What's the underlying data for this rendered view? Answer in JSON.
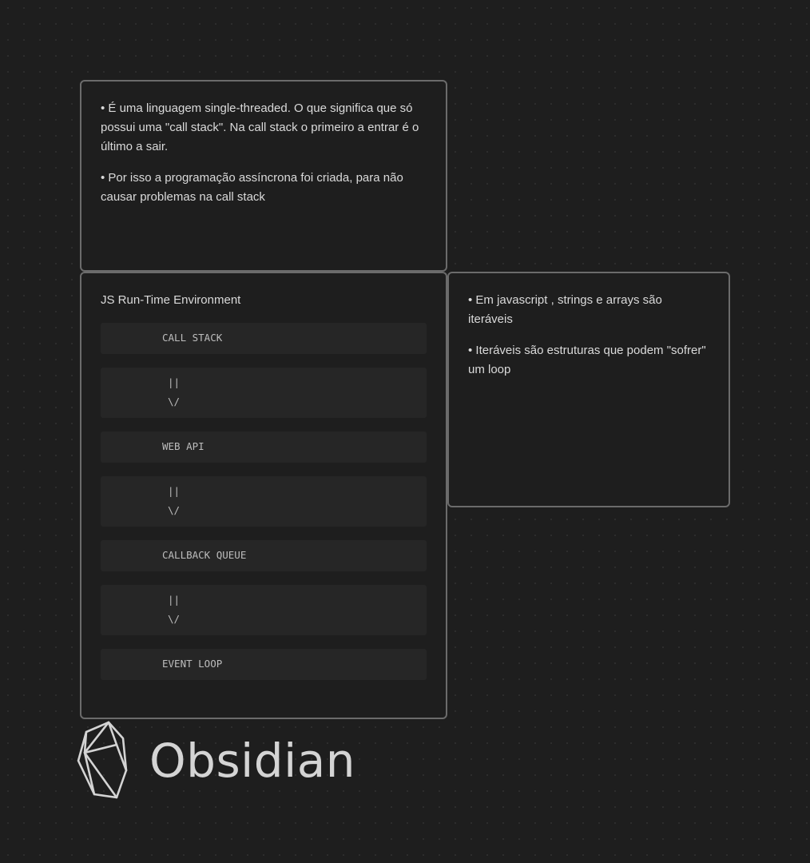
{
  "card_single_thread": {
    "bullets": [
      "É uma linguagem single-threaded. O que significa que só possui uma \"call stack\". Na call stack o primeiro a entrar é o último a sair.",
      "Por isso a programação assíncrona foi criada, para não causar problemas na call stack"
    ]
  },
  "card_runtime": {
    "title": "JS Run-Time Environment",
    "blocks": [
      "CALL STACK",
      "||\n\\/",
      "WEB API",
      "||\n\\/",
      "CALLBACK QUEUE",
      "||\n\\/",
      "EVENT LOOP"
    ]
  },
  "card_iterables": {
    "bullets": [
      "Em javascript , strings e arrays são iteráveis",
      "Iteráveis são estruturas que podem \"sofrer\" um loop"
    ]
  },
  "logo": {
    "text": "Obsidian",
    "icon": "obsidian-crystal-icon"
  },
  "colors": {
    "background": "#1e1e1e",
    "card_border": "#6b6b6b",
    "code_block_bg": "#262626",
    "text": "#dadada"
  }
}
